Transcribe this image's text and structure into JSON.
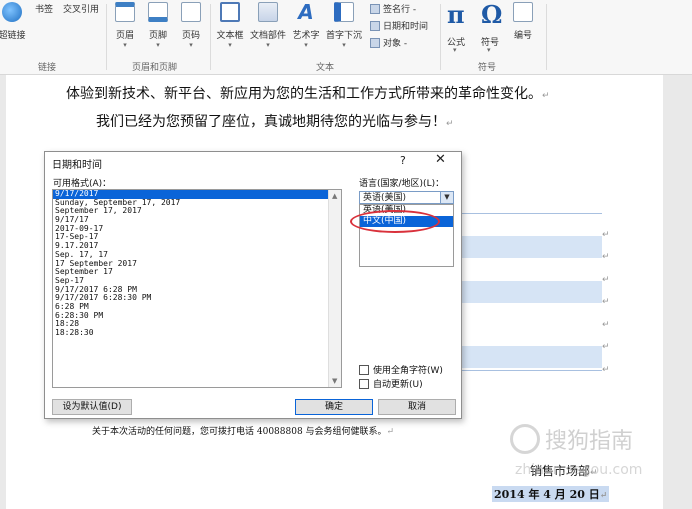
{
  "ribbon": {
    "links_group": {
      "hyperlink": "超链接",
      "bookmark": "书签",
      "cross_ref": "交叉引用",
      "label": "链接"
    },
    "header_footer_group": {
      "header": "页眉",
      "footer": "页脚",
      "page_number": "页码",
      "label": "页眉和页脚"
    },
    "text_group": {
      "textbox": "文本框",
      "quick_parts": "文档部件",
      "wordart": "艺术字",
      "dropcap": "首字下沉",
      "signature_line": "签名行 -",
      "datetime": "日期和时间",
      "object": "对象 -",
      "label": "文本"
    },
    "symbols_group": {
      "equation": "公式",
      "symbol": "符号",
      "number": "编号",
      "label": "符号"
    },
    "dropdown_mark": "▾"
  },
  "document": {
    "line1": "体验到新技术、新平台、新应用为您的生活和工作方式所带来的革命性变化。",
    "line2": "我们已经为您预留了座位，真诚地期待您的光临与参与！",
    "contact": "关于本次活动的任何问题，您可拨打电话 40088808 与会务组何健联系。",
    "dept": "销售市场部",
    "date": "2014 年 4 月 20 日",
    "para_mark": "↵"
  },
  "dialog": {
    "title": "日期和时间",
    "help": "?",
    "close": "✕",
    "formats_label": "可用格式(A)：",
    "formats": [
      "9/17/2017",
      "Sunday, September 17, 2017",
      "September 17, 2017",
      "9/17/17",
      "2017-09-17",
      "17-Sep-17",
      "9.17.2017",
      "Sep. 17, 17",
      "17 September 2017",
      "September 17",
      "Sep-17",
      "9/17/2017 6:28 PM",
      "9/17/2017 6:28:30 PM",
      "6:28 PM",
      "6:28:30 PM",
      "18:28",
      "18:28:30"
    ],
    "language_label": "语言(国家/地区)(L)：",
    "language_selected": "英语(美国)",
    "languages": [
      "英语(美国)",
      "中文(中国)"
    ],
    "fullwidth_label": "使用全角字符(W)",
    "autoupdate_label": "自动更新(U)",
    "set_default": "设为默认值(D)",
    "ok": "确定",
    "cancel": "取消",
    "scroll_up": "▲",
    "scroll_down": "▼",
    "combo_arrow": "▼"
  },
  "watermark": {
    "brand": "搜狗指南",
    "url": "zhinan.sogou.com"
  },
  "colors": {
    "selection": "#0a64d8",
    "highlight_oval": "#d9313b",
    "ribbon_blue": "#1f5aa6"
  }
}
